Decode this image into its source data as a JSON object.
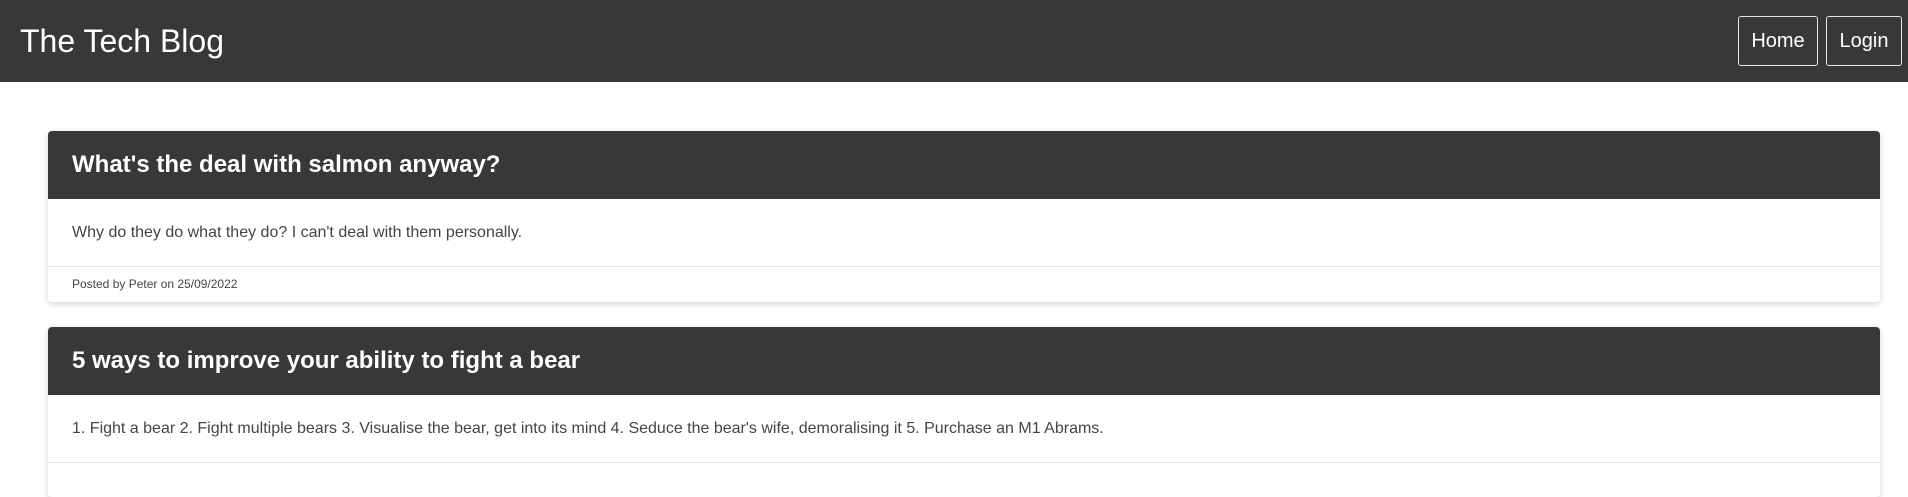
{
  "navbar": {
    "brand": "The Tech Blog",
    "links": [
      {
        "label": "Home"
      },
      {
        "label": "Login"
      }
    ]
  },
  "posts": [
    {
      "title": "What's the deal with salmon anyway?",
      "content": "Why do they do what they do? I can't deal with them personally.",
      "meta": "Posted by Peter on 25/09/2022"
    },
    {
      "title": "5 ways to improve your ability to fight a bear",
      "content": "1. Fight a bear 2. Fight multiple bears 3. Visualise the bear, get into its mind 4. Seduce the bear's wife, demoralising it 5. Purchase an M1 Abrams."
    }
  ]
}
